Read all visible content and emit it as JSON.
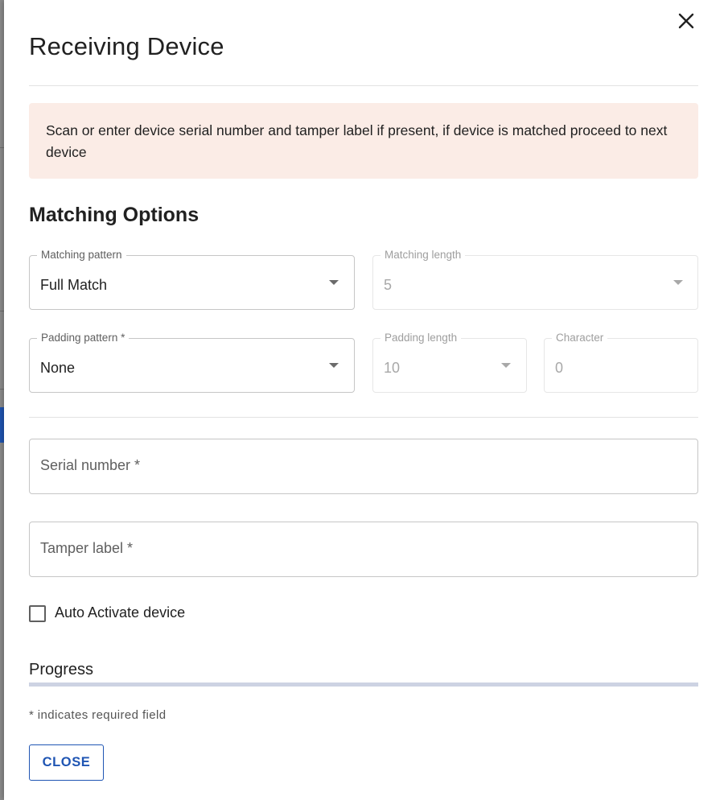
{
  "dialog": {
    "title": "Receiving Device",
    "alert_text": "Scan or enter device serial number and tamper label if present, if device is matched proceed to next device"
  },
  "matching": {
    "section_title": "Matching Options",
    "pattern": {
      "label": "Matching pattern",
      "value": "Full Match"
    },
    "length": {
      "label": "Matching length",
      "value": "5"
    },
    "padding_pattern": {
      "label": "Padding pattern *",
      "value": "None"
    },
    "padding_length": {
      "label": "Padding length",
      "value": "10"
    },
    "character": {
      "label": "Character",
      "value": "0"
    }
  },
  "inputs": {
    "serial_placeholder": "Serial number *",
    "tamper_placeholder": "Tamper label *"
  },
  "auto_activate": {
    "label": "Auto Activate device",
    "checked": false
  },
  "progress": {
    "label": "Progress",
    "value": 0
  },
  "footer": {
    "required_note": "* indicates required field",
    "close_label": "CLOSE"
  },
  "icons": {
    "close": "close-icon",
    "dropdown": "chevron-down-icon"
  },
  "colors": {
    "primary": "#1f55b3",
    "alert_bg": "#fbece6",
    "progress_track": "#cdd3e3"
  }
}
